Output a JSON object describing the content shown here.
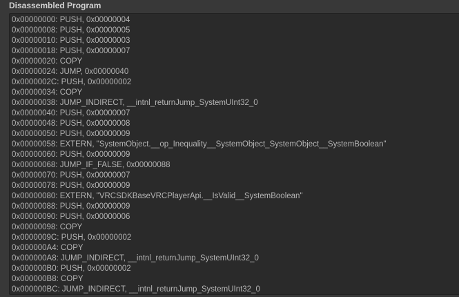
{
  "panel": {
    "title": "Disassembled Program"
  },
  "lines": [
    "0x00000000: PUSH, 0x00000004",
    "0x00000008: PUSH, 0x00000005",
    "0x00000010: PUSH, 0x00000003",
    "0x00000018: PUSH, 0x00000007",
    "0x00000020: COPY",
    "0x00000024: JUMP, 0x00000040",
    "0x0000002C: PUSH, 0x00000002",
    "0x00000034: COPY",
    "0x00000038: JUMP_INDIRECT, __intnl_returnJump_SystemUInt32_0",
    "0x00000040: PUSH, 0x00000007",
    "0x00000048: PUSH, 0x00000008",
    "0x00000050: PUSH, 0x00000009",
    "0x00000058: EXTERN, \"SystemObject.__op_Inequality__SystemObject_SystemObject__SystemBoolean\"",
    "0x00000060: PUSH, 0x00000009",
    "0x00000068: JUMP_IF_FALSE, 0x00000088",
    "0x00000070: PUSH, 0x00000007",
    "0x00000078: PUSH, 0x00000009",
    "0x00000080: EXTERN, \"VRCSDKBaseVRCPlayerApi.__IsValid__SystemBoolean\"",
    "0x00000088: PUSH, 0x00000009",
    "0x00000090: PUSH, 0x00000006",
    "0x00000098: COPY",
    "0x0000009C: PUSH, 0x00000002",
    "0x000000A4: COPY",
    "0x000000A8: JUMP_INDIRECT, __intnl_returnJump_SystemUInt32_0",
    "0x000000B0: PUSH, 0x00000002",
    "0x000000B8: COPY",
    "0x000000BC: JUMP_INDIRECT, __intnl_returnJump_SystemUInt32_0"
  ]
}
